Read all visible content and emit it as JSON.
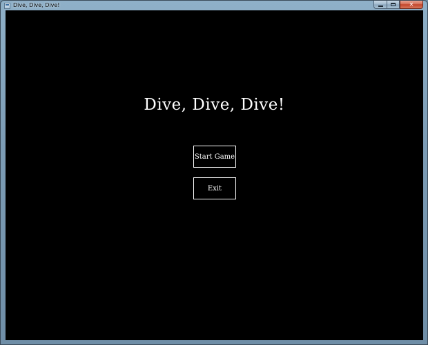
{
  "window": {
    "title": "Dive, Dive, Dive!",
    "caption": {
      "minimize_label": "",
      "maximize_label": "",
      "close_label": "✕"
    }
  },
  "game": {
    "title": "Dive, Dive, Dive!",
    "menu": {
      "start_label": "Start Game",
      "exit_label": "Exit"
    }
  },
  "colors": {
    "background": "#000000",
    "text": "#ffffff",
    "button_border": "#ffffff"
  }
}
